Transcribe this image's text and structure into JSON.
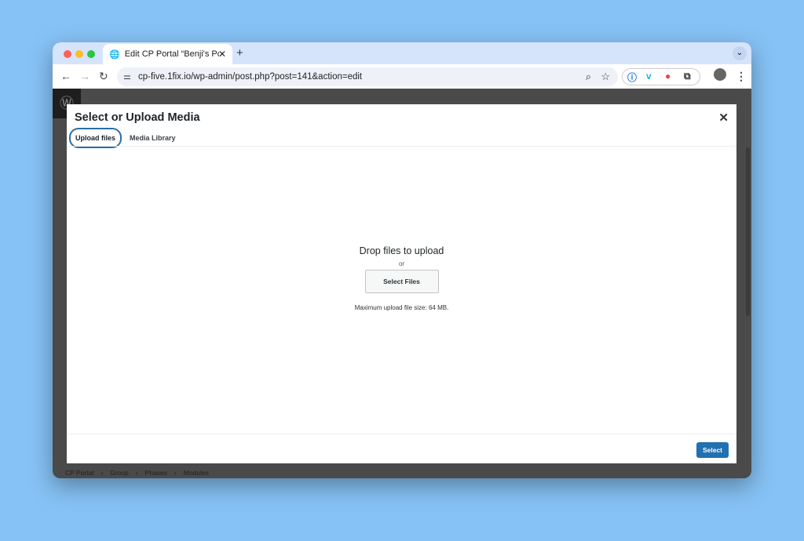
{
  "browser": {
    "tab_title": "Edit CP Portal “Benji's Portal”",
    "url": "cp-five.1fix.io/wp-admin/post.php?post=141&action=edit",
    "traffic_lights": [
      "#fe5f57",
      "#febc2e",
      "#28c840"
    ]
  },
  "breadcrumb": [
    "CP Portal",
    "Group",
    "Phases",
    "Modules"
  ],
  "modal": {
    "title": "Select or Upload Media",
    "tabs": [
      {
        "label": "Upload files",
        "active": true
      },
      {
        "label": "Media Library",
        "active": false
      }
    ],
    "drop_text": "Drop files to upload",
    "or_text": "or",
    "select_files_label": "Select Files",
    "max_size_text": "Maximum upload file size: 64 MB.",
    "select_label": "Select",
    "accent": "#2271b1"
  }
}
